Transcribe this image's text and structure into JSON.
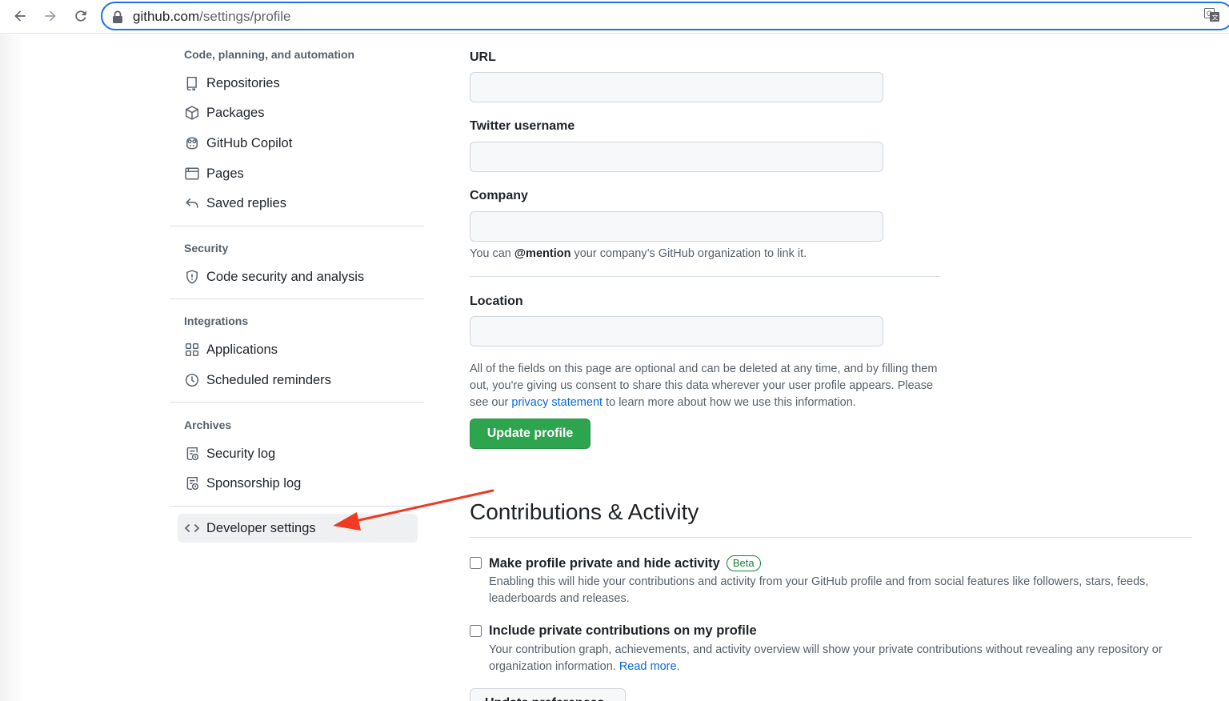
{
  "browser": {
    "url_host": "github.com",
    "url_path": "/settings/profile"
  },
  "sidebar": {
    "groups": [
      {
        "heading": "Code, planning, and automation",
        "items": [
          {
            "label": "Repositories",
            "icon": "repo-icon"
          },
          {
            "label": "Packages",
            "icon": "package-icon"
          },
          {
            "label": "GitHub Copilot",
            "icon": "copilot-icon"
          },
          {
            "label": "Pages",
            "icon": "browser-icon"
          },
          {
            "label": "Saved replies",
            "icon": "reply-icon"
          }
        ]
      },
      {
        "heading": "Security",
        "items": [
          {
            "label": "Code security and analysis",
            "icon": "shield-icon"
          }
        ]
      },
      {
        "heading": "Integrations",
        "items": [
          {
            "label": "Applications",
            "icon": "apps-icon"
          },
          {
            "label": "Scheduled reminders",
            "icon": "clock-icon"
          }
        ]
      },
      {
        "heading": "Archives",
        "items": [
          {
            "label": "Security log",
            "icon": "log-icon"
          },
          {
            "label": "Sponsorship log",
            "icon": "log-icon"
          }
        ]
      }
    ],
    "developer_settings": {
      "label": "Developer settings",
      "icon": "code-icon"
    }
  },
  "form": {
    "url": {
      "label": "URL",
      "value": ""
    },
    "twitter": {
      "label": "Twitter username",
      "value": ""
    },
    "company": {
      "label": "Company",
      "value": "",
      "hint_before": "You can ",
      "hint_bold": "@mention",
      "hint_after": " your company’s GitHub organization to link it."
    },
    "location": {
      "label": "Location",
      "value": ""
    },
    "note_before": "All of the fields on this page are optional and can be deleted at any time, and by filling them out, you're giving us consent to share this data wherever your user profile appears. Please see our ",
    "note_link": "privacy statement",
    "note_after": " to learn more about how we use this information.",
    "update_button": "Update profile"
  },
  "contributions": {
    "title": "Contributions & Activity",
    "options": [
      {
        "title": "Make profile private and hide activity",
        "badge": "Beta",
        "checked": false,
        "description": "Enabling this will hide your contributions and activity from your GitHub profile and from social features like followers, stars, feeds, leaderboards and releases."
      },
      {
        "title": "Include private contributions on my profile",
        "checked": false,
        "description_before": "Your contribution graph, achievements, and activity overview will show your private contributions without revealing any repository or organization information. ",
        "description_link": "Read more",
        "description_after": "."
      }
    ],
    "update_button_partial": "Update preferences"
  },
  "colors": {
    "primary_button": "#2da44e",
    "link": "#0969da",
    "annotation_arrow": "#f03a24",
    "omnibox_focus": "#1a73e8"
  }
}
